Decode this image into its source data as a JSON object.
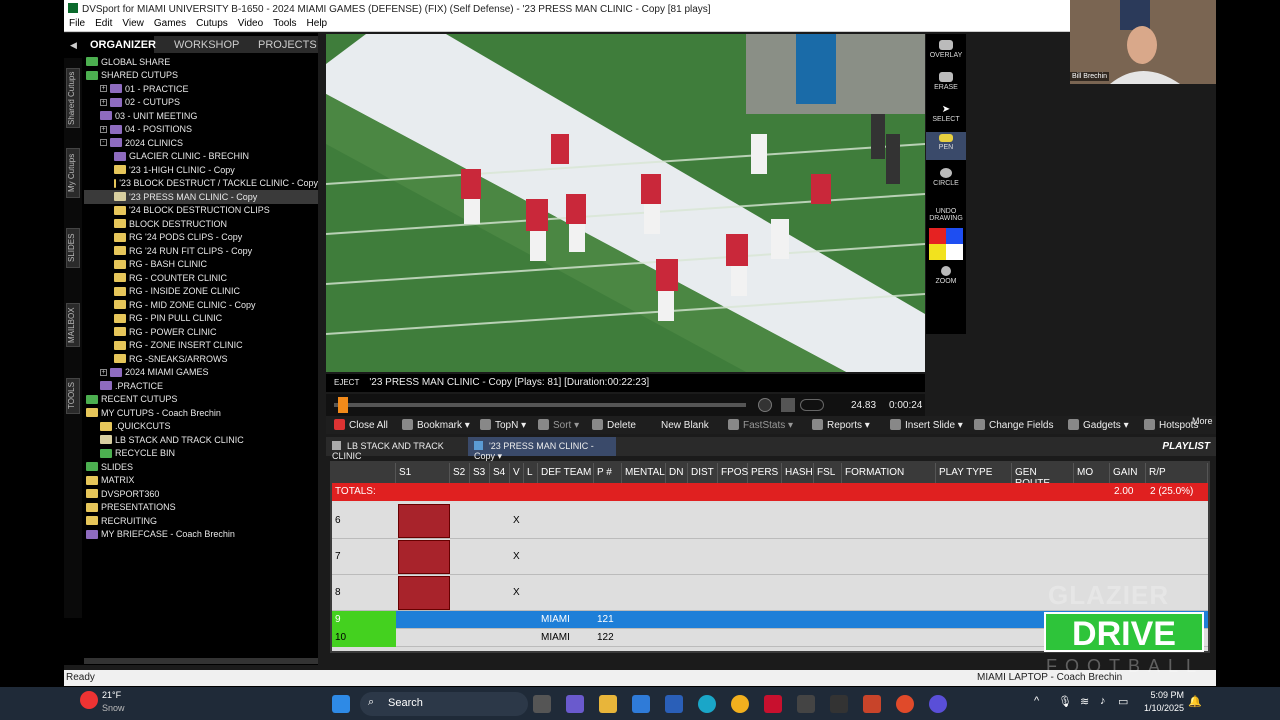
{
  "window": {
    "title": "DVSport for MIAMI UNIVERSITY B-1650 - 2024 MIAMI GAMES (DEFENSE) (FIX) (Self Defense) - '23 PRESS MAN CLINIC - Copy [81 plays]",
    "menu": [
      "File",
      "Edit",
      "View",
      "Games",
      "Cutups",
      "Video",
      "Tools",
      "Help"
    ]
  },
  "side_tabs": [
    "Shared Cutups",
    "My Cutups",
    "SLIDES",
    "MAILBOX",
    "TOOLS"
  ],
  "organizer_tabs": [
    "ORGANIZER",
    "WORKSHOP",
    "PROJECTS"
  ],
  "tree": [
    {
      "label": "GLOBAL SHARE",
      "indent": 0,
      "folder": "g",
      "exp": ""
    },
    {
      "label": "SHARED CUTUPS",
      "indent": 0,
      "folder": "g",
      "exp": ""
    },
    {
      "label": "01 - PRACTICE",
      "indent": 1,
      "folder": "p",
      "exp": "+"
    },
    {
      "label": "02 - CUTUPS",
      "indent": 1,
      "folder": "p",
      "exp": "+"
    },
    {
      "label": "03 - UNIT MEETING",
      "indent": 1,
      "folder": "p",
      "exp": ""
    },
    {
      "label": "04 - POSITIONS",
      "indent": 1,
      "folder": "p",
      "exp": "+"
    },
    {
      "label": "2024 CLINICS",
      "indent": 1,
      "folder": "p",
      "exp": "-"
    },
    {
      "label": "GLACIER CLINIC - BRECHIN",
      "indent": 2,
      "folder": "p",
      "exp": ""
    },
    {
      "label": "'23 1-HIGH CLINIC - Copy",
      "indent": 2,
      "folder": "y",
      "exp": ""
    },
    {
      "label": "'23 BLOCK DESTRUCT / TACKLE CLINIC - Copy",
      "indent": 2,
      "folder": "y",
      "exp": ""
    },
    {
      "label": "'23 PRESS MAN CLINIC - Copy",
      "indent": 2,
      "folder": "l",
      "exp": "",
      "selected": true
    },
    {
      "label": "'24 BLOCK DESTRUCTION CLIPS",
      "indent": 2,
      "folder": "y",
      "exp": ""
    },
    {
      "label": "BLOCK DESTRUCTION",
      "indent": 2,
      "folder": "y",
      "exp": ""
    },
    {
      "label": "RG '24 PODS CLIPS - Copy",
      "indent": 2,
      "folder": "y",
      "exp": ""
    },
    {
      "label": "RG '24 RUN FIT CLIPS - Copy",
      "indent": 2,
      "folder": "y",
      "exp": ""
    },
    {
      "label": "RG - BASH CLINIC",
      "indent": 2,
      "folder": "y",
      "exp": ""
    },
    {
      "label": "RG - COUNTER CLINIC",
      "indent": 2,
      "folder": "y",
      "exp": ""
    },
    {
      "label": "RG - INSIDE ZONE CLINIC",
      "indent": 2,
      "folder": "y",
      "exp": ""
    },
    {
      "label": "RG - MID ZONE CLINIC - Copy",
      "indent": 2,
      "folder": "y",
      "exp": ""
    },
    {
      "label": "RG - PIN PULL CLINIC",
      "indent": 2,
      "folder": "y",
      "exp": ""
    },
    {
      "label": "RG - POWER CLINIC",
      "indent": 2,
      "folder": "y",
      "exp": ""
    },
    {
      "label": "RG - ZONE INSERT CLINIC",
      "indent": 2,
      "folder": "y",
      "exp": ""
    },
    {
      "label": "RG -SNEAKS/ARROWS",
      "indent": 2,
      "folder": "y",
      "exp": ""
    },
    {
      "label": "2024 MIAMI GAMES",
      "indent": 1,
      "folder": "p",
      "exp": "+"
    },
    {
      "label": ".PRACTICE",
      "indent": 1,
      "folder": "p",
      "exp": ""
    },
    {
      "label": "RECENT CUTUPS",
      "indent": 0,
      "folder": "g",
      "exp": ""
    },
    {
      "label": "MY CUTUPS - Coach Brechin",
      "indent": 0,
      "folder": "y",
      "exp": ""
    },
    {
      "label": ".QUICKCUTS",
      "indent": 1,
      "folder": "y",
      "exp": ""
    },
    {
      "label": "LB STACK AND TRACK CLINIC",
      "indent": 1,
      "folder": "l",
      "exp": ""
    },
    {
      "label": "RECYCLE BIN",
      "indent": 1,
      "folder": "g",
      "exp": ""
    },
    {
      "label": "SLIDES",
      "indent": 0,
      "folder": "g",
      "exp": ""
    },
    {
      "label": "MATRIX",
      "indent": 0,
      "folder": "y",
      "exp": ""
    },
    {
      "label": "DVSPORT360",
      "indent": 0,
      "folder": "y",
      "exp": ""
    },
    {
      "label": "PRESENTATIONS",
      "indent": 0,
      "folder": "y",
      "exp": ""
    },
    {
      "label": "RECRUITING",
      "indent": 0,
      "folder": "y",
      "exp": ""
    },
    {
      "label": "MY BRIEFCASE - Coach Brechin",
      "indent": 0,
      "folder": "p",
      "exp": ""
    }
  ],
  "drawing_tools": [
    "OVERLAY",
    "ERASE",
    "SELECT",
    "PEN",
    "CIRCLE",
    "UNDO DRAWING",
    "ZOOM"
  ],
  "palette": [
    "#e52222",
    "#1e4ef2",
    "#f2e21e",
    "#ffffff"
  ],
  "player": {
    "eject": "EJECT",
    "clip_info": "'23 PRESS MAN CLINIC - Copy  [Plays: 81]  [Duration:00:22:23]",
    "frame": "24.83",
    "time": "0:00:24"
  },
  "toolbar": [
    "Close All",
    "Bookmark",
    "TopN",
    "Sort",
    "Delete",
    "New Blank",
    "FastStats",
    "Reports",
    "Insert Slide",
    "Change Fields",
    "Gadgets",
    "Hotspots",
    "More"
  ],
  "cutup_tabs": [
    "LB STACK AND TRACK CLINIC",
    "'23 PRESS MAN CLINIC - Copy"
  ],
  "playlist_label": "PLAYLIST",
  "grid": {
    "columns": [
      "",
      "S1",
      "S2",
      "S3",
      "S4",
      "V",
      "L",
      "DEF TEAM",
      "P #",
      "MENTAL",
      "DN",
      "DIST",
      "FPOS",
      "PERS",
      "HASH",
      "FSL",
      "FORMATION",
      "PLAY TYPE",
      "GEN ROUTE",
      "MO",
      "GAIN",
      "R/P"
    ],
    "totals": {
      "label": "TOTALS:",
      "gain": "2.00",
      "rp": "2 (25.0%)"
    },
    "rows": [
      {
        "num": "6",
        "v": "X",
        "team": "",
        "play": ""
      },
      {
        "num": "7",
        "v": "X",
        "team": "",
        "play": ""
      },
      {
        "num": "8",
        "v": "X",
        "team": "",
        "play": ""
      },
      {
        "num": "9",
        "v": "",
        "team": "MIAMI",
        "play": "121"
      },
      {
        "num": "10",
        "v": "",
        "team": "MIAMI",
        "play": "122"
      }
    ]
  },
  "status": {
    "left": "Ready",
    "right": "MIAMI LAPTOP - Coach Brechin"
  },
  "webcam_name": "Bill Brechin",
  "watermark": {
    "top": "GLAZIER",
    "mid": "DRIVE",
    "bottom": "FOOTBALL"
  },
  "taskbar": {
    "weather_temp": "21°F",
    "weather_desc": "Snow",
    "search": "Search",
    "time": "5:09 PM",
    "date": "1/10/2025"
  },
  "colors": {
    "totals_bg": "#e02020",
    "selected_row": "#1e7fd8",
    "green_cell": "#44d11f",
    "watermark_green": "#2ec43a"
  }
}
